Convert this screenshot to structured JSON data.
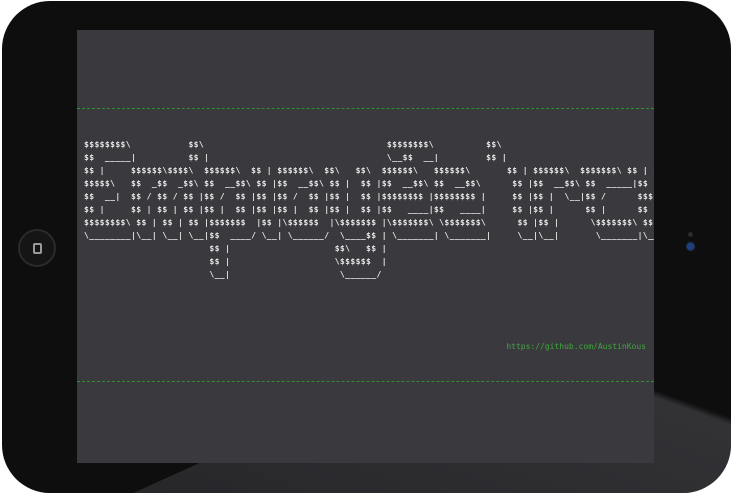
{
  "banner": {
    "lines": [
      "$$$$$$$$\\           $$\\                                   $$$$$$$$\\          $$\\",
      "$$  _____|          $$ |                                  \\__$$  __|         $$ |",
      "$$ |     $$$$$$\\$$$$\\  $$$$$$\\  $$ | $$$$$$\\  $$\\   $$\\  $$$$$$\\   $$$$$$\\       $$ | $$$$$$\\  $$$$$$$\\ $$ | $$\\  $$$$$$\\   $$$$$$\\",
      "$$$$$\\   $$  _$$  _$$\\ $$  __$$\\ $$ |$$  __$$\\ $$ |  $$ |$$  __$$\\ $$  __$$\\      $$ |$$  __$$\\ $$  _____|$$ | $$  |$$  __$$\\ $$  __$$\\",
      "$$  __|  $$ / $$ / $$ |$$ /  $$ |$$ |$$ /  $$ |$$ |  $$ |$$$$$$$$ |$$$$$$$$ |     $$ |$$ |  \\__|$$ /      $$$$$$  / $$$$$$$$ |$$ |  \\__|",
      "$$ |     $$ | $$ | $$ |$$ |  $$ |$$ |$$ |  $$ |$$ |  $$ |$$   ____|$$   ____|     $$ |$$ |      $$ |      $$  _$$<  $$   ____|$$ |",
      "$$$$$$$$\\ $$ | $$ | $$ |$$$$$$$  |$$ |\\$$$$$$  |\\$$$$$$$ |\\$$$$$$$\\ \\$$$$$$$\\      $$ |$$ |      \\$$$$$$$\\ $$ | \\$$\\ \\$$$$$$$\\ $$ |",
      "\\________|\\__| \\__| \\__|$$  ____/ \\__| \\______/  \\____$$ | \\_______| \\_______|     \\__|\\__|       \\_______|\\__|  \\__| \\_______|\\__|",
      "                        $$ |                    $$\\   $$ |",
      "                        $$ |                    \\$$$$$$  |",
      "                        \\__|                     \\______/"
    ],
    "text": ""
  },
  "link": {
    "text": "https://github.com/AustinKous"
  },
  "colors": {
    "screen_bg": "#3a393d",
    "banner_text": "#e8e8e8",
    "accent_green": "#3fa83f"
  },
  "icons": {
    "home": "home-button-icon"
  }
}
